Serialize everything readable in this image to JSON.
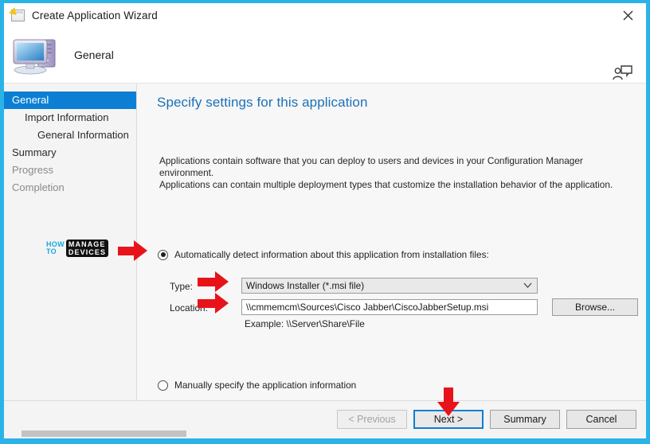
{
  "window": {
    "title": "Create Application Wizard",
    "icon": "wizard-window-icon",
    "close_label": "✕"
  },
  "header": {
    "label": "General",
    "icon": "computer-icon",
    "help_icon": "help-person-icon"
  },
  "sidebar": {
    "items": [
      {
        "label": "General",
        "state": "selected",
        "indent": 0
      },
      {
        "label": "Import Information",
        "state": "normal",
        "indent": 1
      },
      {
        "label": "General Information",
        "state": "normal",
        "indent": 2
      },
      {
        "label": "Summary",
        "state": "normal",
        "indent": 0
      },
      {
        "label": "Progress",
        "state": "dim",
        "indent": 0
      },
      {
        "label": "Completion",
        "state": "dim",
        "indent": 0
      }
    ]
  },
  "main": {
    "heading": "Specify settings for this application",
    "description_line1": "Applications contain software that you can deploy to users and devices in your Configuration Manager environment.",
    "description_line2": "Applications can contain multiple deployment types that customize the installation behavior of the application.",
    "auto_radio_label": "Automatically detect information about this application from installation files:",
    "auto_radio_selected": true,
    "type_label": "Type:",
    "type_value": "Windows Installer (*.msi file)",
    "location_label": "Location:",
    "location_value": "\\\\cmmemcm\\Sources\\Cisco Jabber\\CiscoJabberSetup.msi",
    "location_placeholder": "\\\\Server\\Share\\File",
    "example_text": "Example: \\\\Server\\Share\\File",
    "browse_label": "Browse...",
    "manual_radio_label": "Manually specify the application information",
    "manual_radio_selected": false
  },
  "footer": {
    "previous_label": "< Previous",
    "next_label": "Next >",
    "summary_label": "Summary",
    "cancel_label": "Cancel"
  },
  "watermark": {
    "how": "HOW",
    "to": "TO",
    "manage": "MANAGE",
    "devices": "DEVICES"
  },
  "colors": {
    "accent_blue": "#0c7fd4",
    "heading_blue": "#1d70b8",
    "border_cyan": "#2bb3e8",
    "annotation_red": "#e8131a"
  }
}
